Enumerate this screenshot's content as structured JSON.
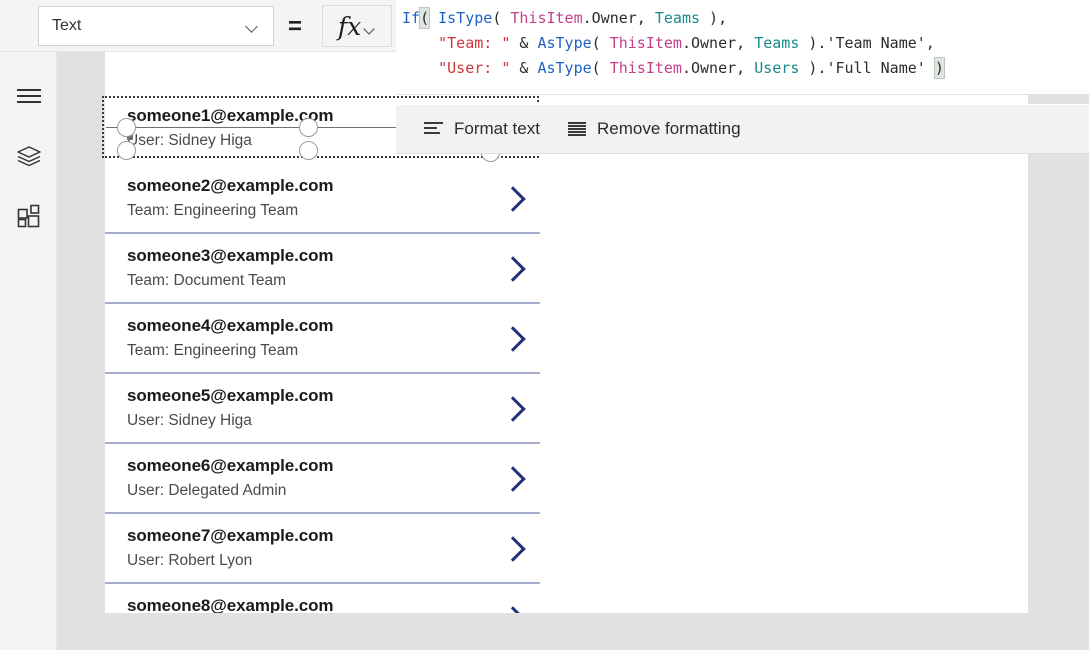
{
  "topbar": {
    "property_select": {
      "value": "Text",
      "icon": "chevron-down-icon"
    },
    "equals": "=",
    "fx_button": {
      "glyph": "fx",
      "icon": "chevron-down-icon"
    }
  },
  "formula_bar": {
    "full_text": "If( IsType( ThisItem.Owner, Teams ),\n    \"Team: \" & AsType( ThisItem.Owner, Teams ).'Team Name',\n    \"User: \" & AsType( ThisItem.Owner, Users ).'Full Name' )",
    "lines": [
      {
        "tokens": [
          {
            "t": "If",
            "c": "tok-if"
          },
          {
            "t": "(",
            "c": "tok-match"
          },
          {
            "t": " ",
            "c": "tok-plain"
          },
          {
            "t": "IsType",
            "c": "tok-fn"
          },
          {
            "t": "( ",
            "c": "tok-paren"
          },
          {
            "t": "ThisItem",
            "c": "tok-ident"
          },
          {
            "t": ".Owner, ",
            "c": "tok-plain"
          },
          {
            "t": "Teams",
            "c": "tok-type"
          },
          {
            "t": " ),",
            "c": "tok-plain"
          }
        ]
      },
      {
        "tokens": [
          {
            "t": "    ",
            "c": "tok-plain"
          },
          {
            "t": "\"Team: \"",
            "c": "tok-str"
          },
          {
            "t": " & ",
            "c": "tok-plain"
          },
          {
            "t": "AsType",
            "c": "tok-fn"
          },
          {
            "t": "( ",
            "c": "tok-paren"
          },
          {
            "t": "ThisItem",
            "c": "tok-ident"
          },
          {
            "t": ".Owner, ",
            "c": "tok-plain"
          },
          {
            "t": "Teams",
            "c": "tok-type"
          },
          {
            "t": " ).'Team Name',",
            "c": "tok-plain"
          }
        ]
      },
      {
        "tokens": [
          {
            "t": "    ",
            "c": "tok-plain"
          },
          {
            "t": "\"User: \"",
            "c": "tok-str"
          },
          {
            "t": " & ",
            "c": "tok-plain"
          },
          {
            "t": "AsType",
            "c": "tok-fn"
          },
          {
            "t": "( ",
            "c": "tok-paren"
          },
          {
            "t": "ThisItem",
            "c": "tok-ident"
          },
          {
            "t": ".Owner, ",
            "c": "tok-plain"
          },
          {
            "t": "Users",
            "c": "tok-type"
          },
          {
            "t": " ).'Full Name' ",
            "c": "tok-plain"
          },
          {
            "t": ")",
            "c": "tok-match"
          }
        ]
      }
    ],
    "colors": {
      "function": "#1f63c4",
      "identifier": "#c1428a",
      "type": "#1a8a8a",
      "string": "#d13438",
      "plain": "#2b2b2b",
      "bracket_match_bg": "#dfe6df"
    }
  },
  "format_toolbar": {
    "items": [
      {
        "label": "Format text",
        "icon": "format-text-icon"
      },
      {
        "label": "Remove formatting",
        "icon": "remove-formatting-icon"
      }
    ]
  },
  "left_rail": {
    "items": [
      {
        "name": "menu",
        "icon": "hamburger-menu-icon"
      },
      {
        "name": "tree-view",
        "icon": "layers-icon"
      },
      {
        "name": "insert",
        "icon": "components-grid-icon"
      }
    ]
  },
  "gallery": {
    "items": [
      {
        "title": "someone1@example.com",
        "subtitle": "User: Sidney Higa",
        "chevron": "chevron-right-icon",
        "selected": true
      },
      {
        "title": "someone2@example.com",
        "subtitle": "Team: Engineering Team",
        "chevron": "chevron-right-icon",
        "selected": false
      },
      {
        "title": "someone3@example.com",
        "subtitle": "Team: Document Team",
        "chevron": "chevron-right-icon",
        "selected": false
      },
      {
        "title": "someone4@example.com",
        "subtitle": "Team: Engineering Team",
        "chevron": "chevron-right-icon",
        "selected": false
      },
      {
        "title": "someone5@example.com",
        "subtitle": "User: Sidney Higa",
        "chevron": "chevron-right-icon",
        "selected": false
      },
      {
        "title": "someone6@example.com",
        "subtitle": "User: Delegated Admin",
        "chevron": "chevron-right-icon",
        "selected": false
      },
      {
        "title": "someone7@example.com",
        "subtitle": "User: Robert Lyon",
        "chevron": "chevron-right-icon",
        "selected": false
      },
      {
        "title": "someone8@example.com",
        "subtitle": "",
        "chevron": "chevron-right-icon",
        "selected": false
      }
    ],
    "separator_color": "#a7aecd",
    "chevron_color": "#22307a"
  },
  "selection": {
    "handle_names": [
      "resize-handle-middle-left",
      "resize-handle-bottom-left",
      "resize-handle-middle-center",
      "resize-handle-bottom-center",
      "resize-handle-bottom-right"
    ]
  }
}
